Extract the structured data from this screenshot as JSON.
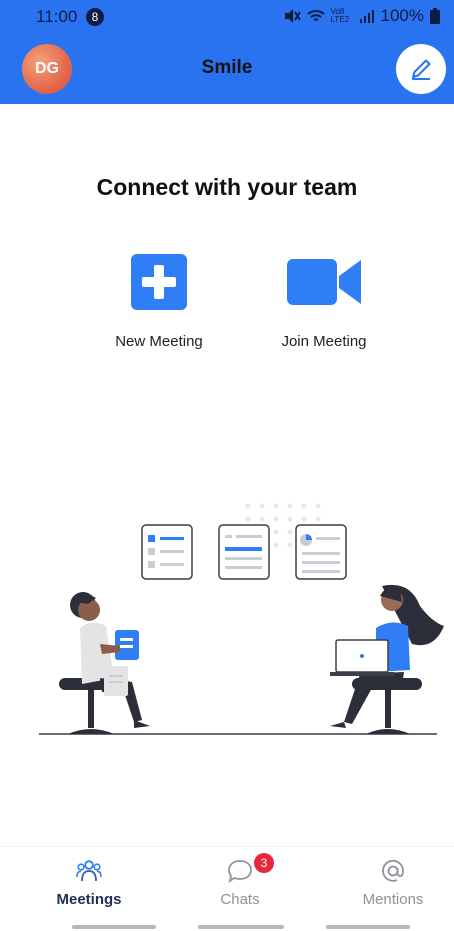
{
  "status_bar": {
    "time": "11:00",
    "notification_count": "8",
    "battery": "100%",
    "network": "Vo8 LTE2"
  },
  "header": {
    "avatar_initials": "DG",
    "title": "Smile"
  },
  "main": {
    "headline": "Connect with your team",
    "actions": [
      {
        "label": "New Meeting",
        "icon": "plus-square-icon"
      },
      {
        "label": "Join Meeting",
        "icon": "video-camera-icon"
      }
    ]
  },
  "tabs": [
    {
      "label": "Meetings",
      "icon": "people-icon",
      "active": true
    },
    {
      "label": "Chats",
      "icon": "chat-bubble-icon",
      "badge": "3"
    },
    {
      "label": "Mentions",
      "icon": "at-icon"
    }
  ],
  "colors": {
    "accent": "#2a73f0",
    "icon_blue": "#2f7ef5",
    "badge_red": "#e8283a"
  }
}
